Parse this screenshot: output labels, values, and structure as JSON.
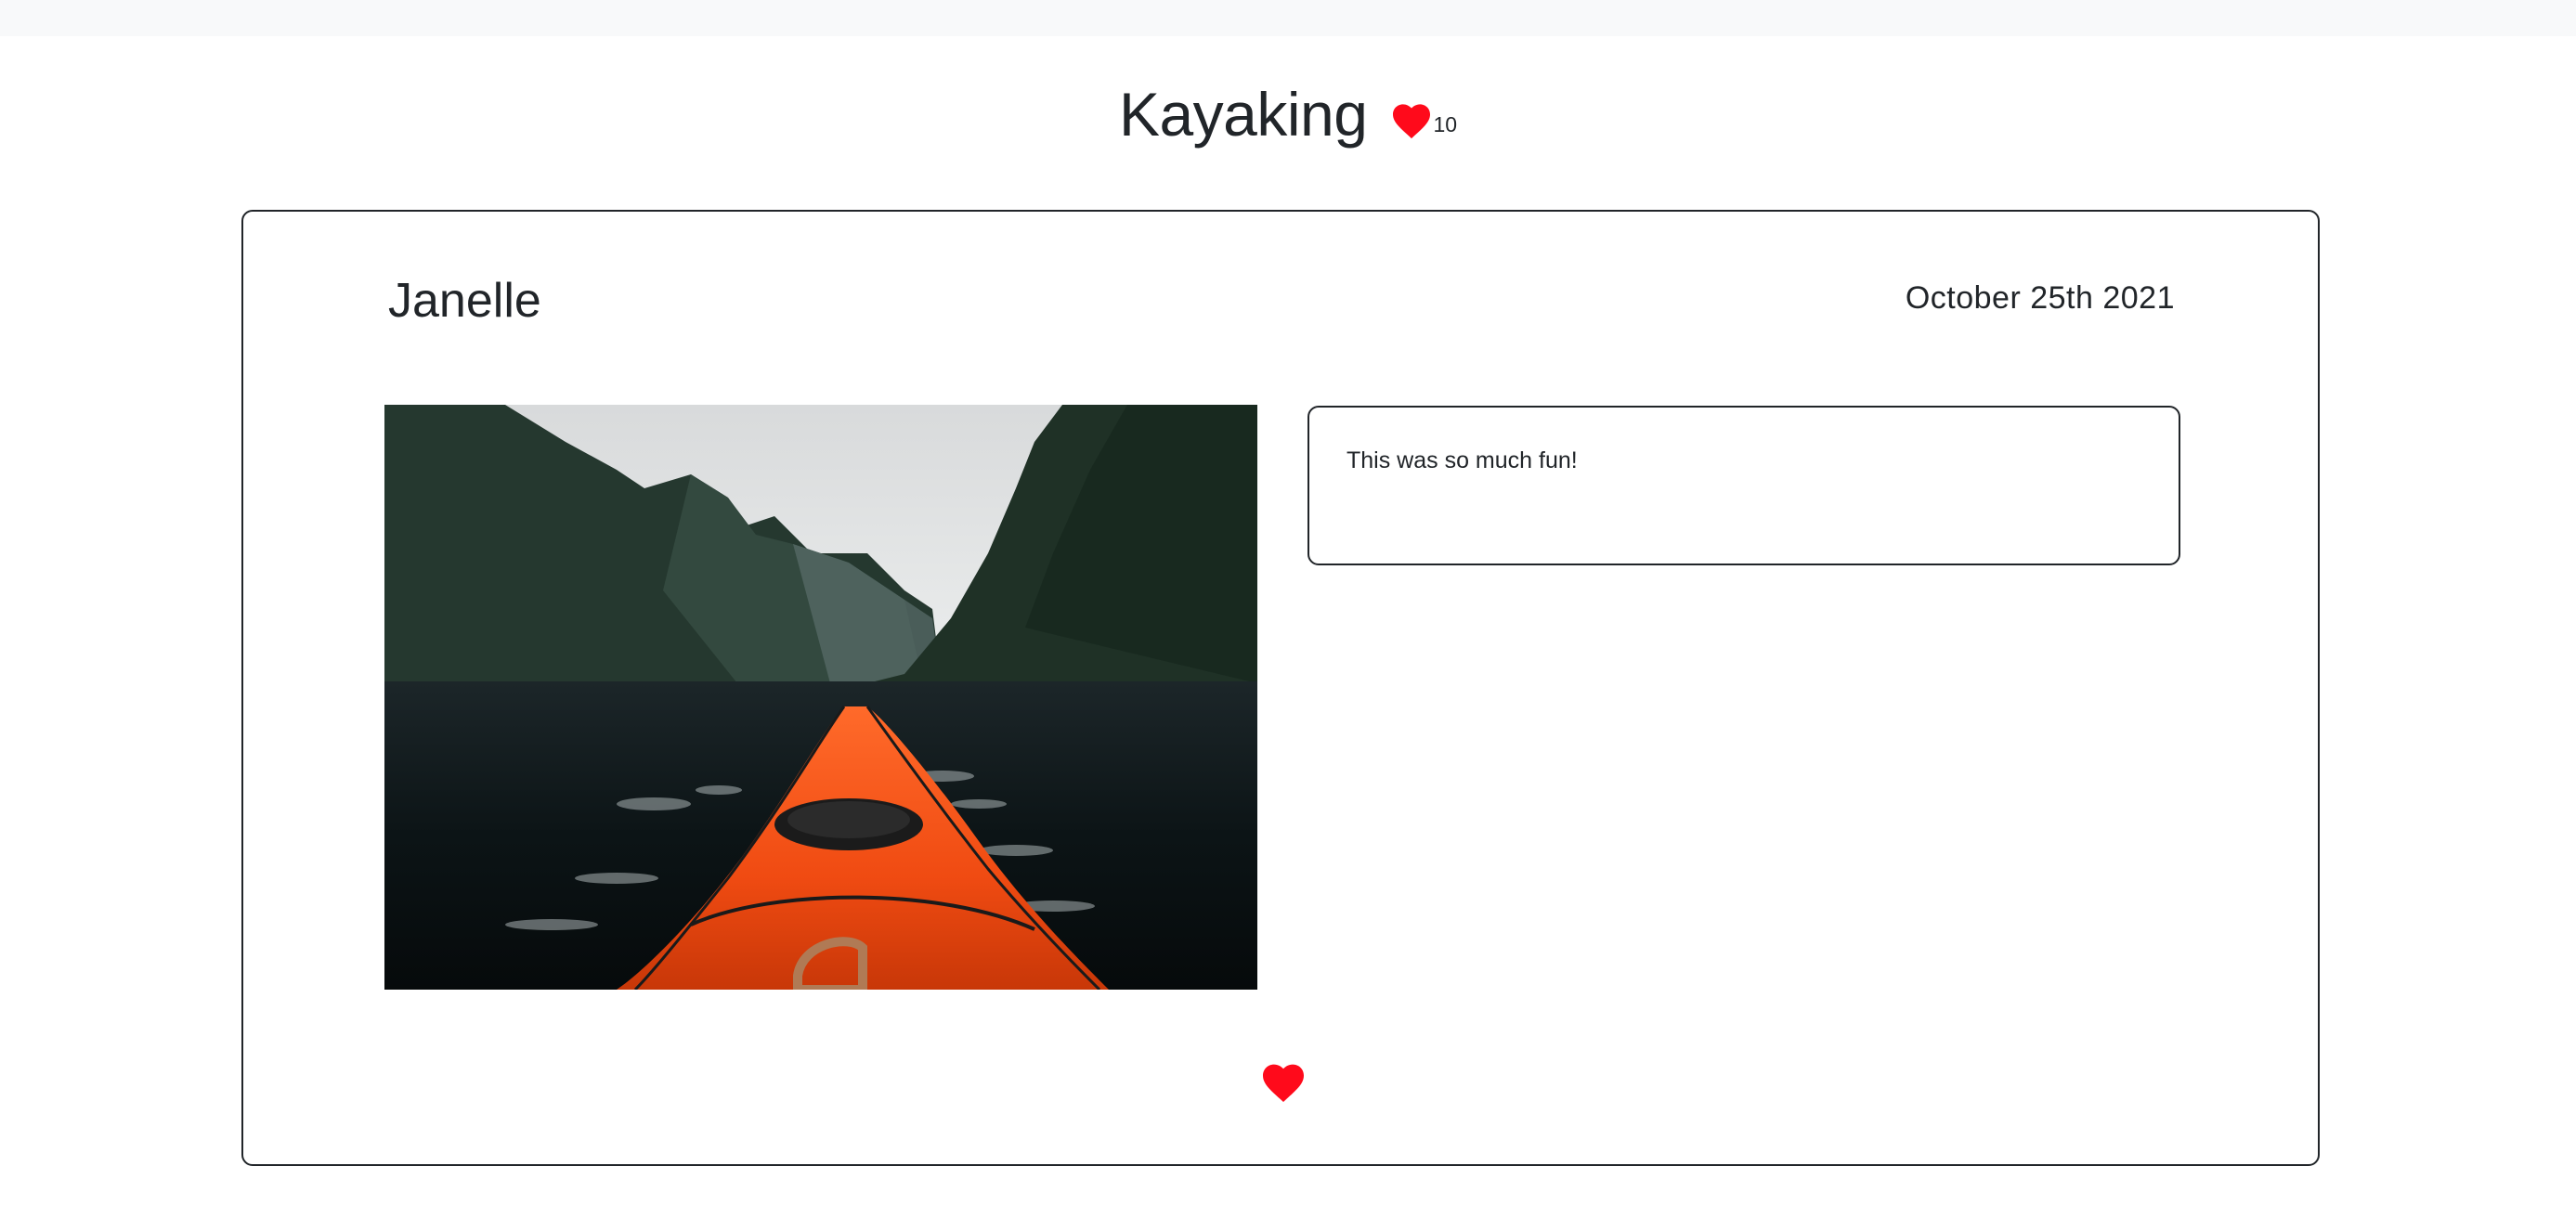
{
  "page": {
    "title": "Kayaking",
    "likes": "10",
    "heart_color": "#ff0a1b"
  },
  "post": {
    "author": "Janelle",
    "date": "October 25th 2021",
    "comment": "This was so much fun!",
    "photo_icon": "kayak-photo",
    "like_icon": "heart-icon"
  }
}
